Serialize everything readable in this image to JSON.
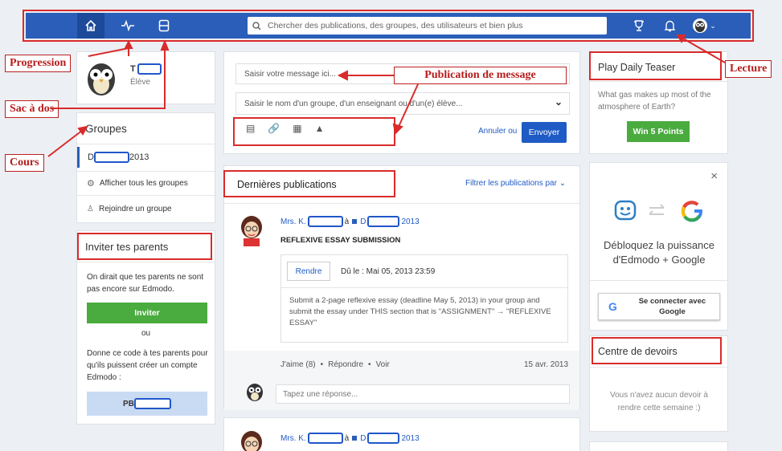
{
  "search": {
    "placeholder": "Chercher des publications, des groupes, des utilisateurs et bien plus"
  },
  "annotations": {
    "progression": "Progression",
    "sac_a_dos": "Sac à dos",
    "cours": "Cours",
    "publication": "Publication de message",
    "lecture": "Lecture"
  },
  "profile": {
    "name": "T",
    "role": "Élève"
  },
  "groups": {
    "title": "Groupes",
    "item_prefix": "D",
    "item_year": "2013",
    "show_all": "Afficher tous les groupes",
    "join": "Rejoindre un groupe"
  },
  "invite": {
    "title": "Inviter tes parents",
    "text": "On dirait que tes parents ne sont pas encore sur Edmodo.",
    "button": "Inviter",
    "or": "ou",
    "code_text": "Donne ce code à tes parents pour qu'ils puissent créer un compte Edmodo :",
    "code_prefix": "PB"
  },
  "composer": {
    "message_placeholder": "Saisir votre message ici...",
    "recipient_placeholder": "Saisir le nom d'un groupe, d'un enseignant ou d'un(e) élève...",
    "cancel": "Annuler ou",
    "send": "Envoyer"
  },
  "feed": {
    "title": "Dernières publications",
    "filter": "Filtrer les publications par",
    "post": {
      "author": "Mrs. K.",
      "to": "à",
      "group_prefix": "D",
      "group_year": "2013",
      "title": "REFLEXIVE ESSAY SUBMISSION",
      "turn_in": "Rendre",
      "due": "Dû le : Mai 05, 2013 23:59",
      "body": "Submit a 2-page reflexive essay (deadline May 5, 2013) in your group and submit the essay under THIS section that is \"ASSIGNMENT\" → \"REFLEXIVE ESSAY\"",
      "like": "J'aime (8)",
      "reply": "Répondre",
      "view": "Voir",
      "date": "15 avr. 2013",
      "reply_placeholder": "Tapez une réponse..."
    },
    "post2": {
      "author": "Mrs. K.",
      "to": "à",
      "group_prefix": "D",
      "group_year": "2013"
    }
  },
  "teaser": {
    "title": "Play Daily Teaser",
    "question": "What gas makes up most of the atmosphere of Earth?",
    "button": "Win 5 Points"
  },
  "google": {
    "close": "×",
    "text": "Débloquez la puissance d'Edmodo + Google",
    "button": "Se connecter avec Google"
  },
  "homework": {
    "title": "Centre de devoirs",
    "empty": "Vous n'avez aucun devoir à rendre cette semaine :)"
  },
  "colors": {
    "navbar": "#2b5eb8",
    "accent": "#1f5bc5",
    "green": "#4aab3f",
    "annotation": "#d92b2b"
  }
}
